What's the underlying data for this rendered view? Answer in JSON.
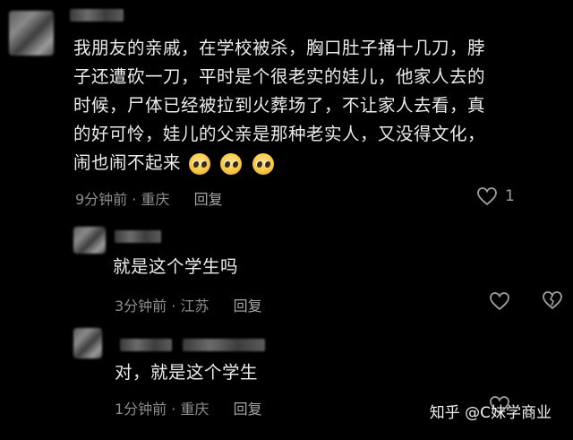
{
  "comments": [
    {
      "text_lines": [
        "我朋友的亲戚，在学校被杀，胸口肚子捅十几刀，脖",
        "子还遭砍一刀，平时是个很老实的娃儿，他家人去的",
        "时候，尸体已经被拉到火葬场了，不让家人去看，真",
        "的好可怜，娃儿的父亲是那种老实人，又没得文化，",
        "闹也闹不起来"
      ],
      "emojis": [
        "crying-face-emoji",
        "crying-face-emoji",
        "crying-face-emoji"
      ],
      "time": "9分钟前",
      "location": "重庆",
      "reply_label": "回复",
      "likes": "1"
    },
    {
      "text": "就是这个学生吗",
      "time": "3分钟前",
      "location": "江苏",
      "reply_label": "回复",
      "likes": ""
    },
    {
      "text": "对，就是这个学生",
      "time": "1分钟前",
      "location": "重庆",
      "reply_label": "回复",
      "likes": ""
    }
  ],
  "meta_separator": "·",
  "watermark": "知乎 @C妹学商业",
  "icons": {
    "like": "heart-outline-icon"
  },
  "colors": {
    "background": "#000000",
    "text": "#ececec",
    "meta": "#8d8d8d"
  }
}
